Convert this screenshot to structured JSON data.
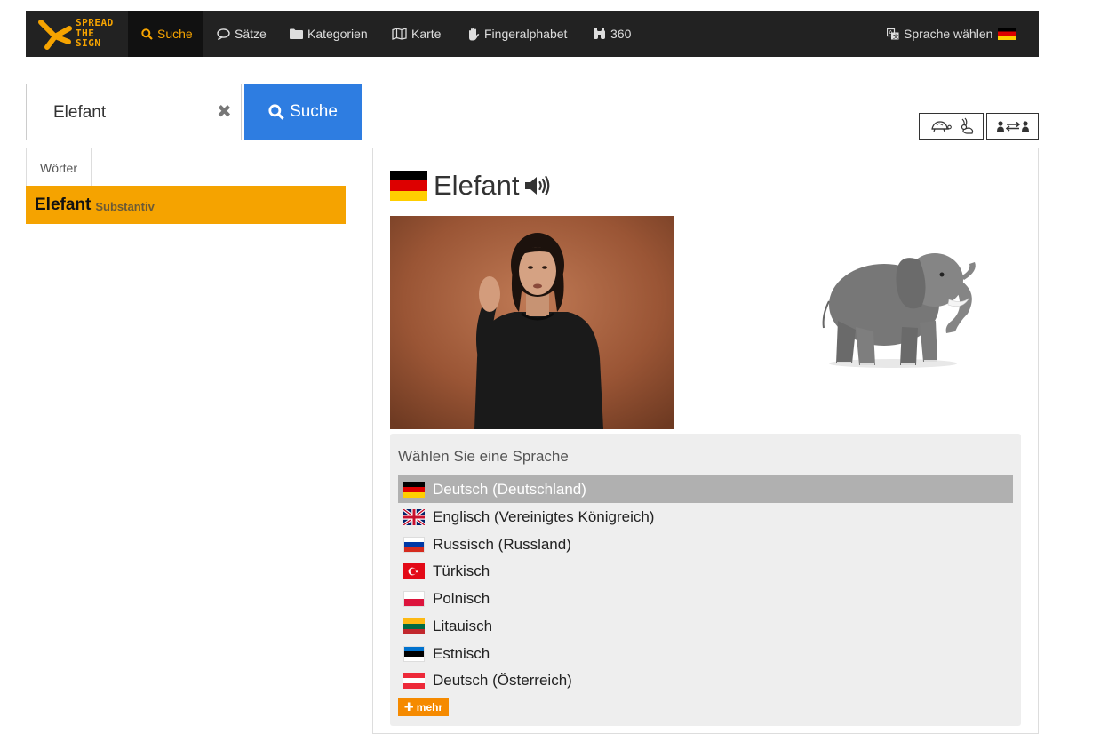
{
  "brand": {
    "logo_line1": "SPREAD",
    "logo_line2": "THE",
    "logo_line3": "SIGN"
  },
  "nav": {
    "suche": "Suche",
    "saetze": "Sätze",
    "kategorien": "Kategorien",
    "karte": "Karte",
    "fingeralphabet": "Fingeralphabet",
    "d360": "360",
    "sprache": "Sprache wählen"
  },
  "search": {
    "value": "Elefant",
    "button": "Suche"
  },
  "tabs": {
    "woerter": "Wörter"
  },
  "result": {
    "word": "Elefant",
    "type": "Substantiv"
  },
  "entry": {
    "word": "Elefant"
  },
  "chooser": {
    "title": "Wählen Sie eine Sprache",
    "languages": [
      {
        "label": "Deutsch (Deutschland)",
        "flag": "de"
      },
      {
        "label": "Englisch (Vereinigtes Königreich)",
        "flag": "gb"
      },
      {
        "label": "Russisch (Russland)",
        "flag": "ru"
      },
      {
        "label": "Türkisch",
        "flag": "tr"
      },
      {
        "label": "Polnisch",
        "flag": "pl"
      },
      {
        "label": "Litauisch",
        "flag": "lt"
      },
      {
        "label": "Estnisch",
        "flag": "ee"
      },
      {
        "label": "Deutsch (Österreich)",
        "flag": "at"
      }
    ],
    "more": "mehr"
  },
  "colors": {
    "accent": "#f5a300",
    "nav_bg": "#222222",
    "search_btn": "#2e7de1",
    "more_btn": "#f58a00"
  }
}
